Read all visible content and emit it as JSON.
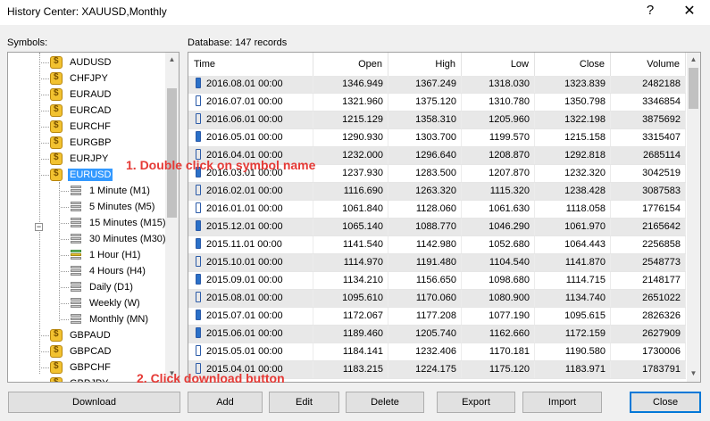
{
  "window": {
    "title": "History Center: XAUUSD,Monthly",
    "help_icon": "?",
    "close_icon": "✕"
  },
  "symbols_label": "Symbols:",
  "database_label": "Database: 147 records",
  "tree": {
    "symbols_before": [
      "AUDUSD",
      "CHFJPY",
      "EURAUD",
      "EURCAD",
      "EURCHF",
      "EURGBP",
      "EURJPY"
    ],
    "selected_symbol": "EURUSD",
    "timeframes": [
      "1 Minute (M1)",
      "5 Minutes (M5)",
      "15 Minutes (M15)",
      "30 Minutes (M30)",
      "1 Hour (H1)",
      "4 Hours (H4)",
      "Daily (D1)",
      "Weekly (W)",
      "Monthly (MN)"
    ],
    "symbols_after": [
      "GBPAUD",
      "GBPCAD",
      "GBPCHF",
      "GBPJPY"
    ]
  },
  "table": {
    "columns": [
      "Time",
      "Open",
      "High",
      "Low",
      "Close",
      "Volume"
    ],
    "rows": [
      [
        "2016.08.01 00:00",
        "1346.949",
        "1367.249",
        "1318.030",
        "1323.839",
        "2482188"
      ],
      [
        "2016.07.01 00:00",
        "1321.960",
        "1375.120",
        "1310.780",
        "1350.798",
        "3346854"
      ],
      [
        "2016.06.01 00:00",
        "1215.129",
        "1358.310",
        "1205.960",
        "1322.198",
        "3875692"
      ],
      [
        "2016.05.01 00:00",
        "1290.930",
        "1303.700",
        "1199.570",
        "1215.158",
        "3315407"
      ],
      [
        "2016.04.01 00:00",
        "1232.000",
        "1296.640",
        "1208.870",
        "1292.818",
        "2685114"
      ],
      [
        "2016.03.01 00:00",
        "1237.930",
        "1283.500",
        "1207.870",
        "1232.320",
        "3042519"
      ],
      [
        "2016.02.01 00:00",
        "1116.690",
        "1263.320",
        "1115.320",
        "1238.428",
        "3087583"
      ],
      [
        "2016.01.01 00:00",
        "1061.840",
        "1128.060",
        "1061.630",
        "1118.058",
        "1776154"
      ],
      [
        "2015.12.01 00:00",
        "1065.140",
        "1088.770",
        "1046.290",
        "1061.970",
        "2165642"
      ],
      [
        "2015.11.01 00:00",
        "1141.540",
        "1142.980",
        "1052.680",
        "1064.443",
        "2256858"
      ],
      [
        "2015.10.01 00:00",
        "1114.970",
        "1191.480",
        "1104.540",
        "1141.870",
        "2548773"
      ],
      [
        "2015.09.01 00:00",
        "1134.210",
        "1156.650",
        "1098.680",
        "1114.715",
        "2148177"
      ],
      [
        "2015.08.01 00:00",
        "1095.610",
        "1170.060",
        "1080.900",
        "1134.740",
        "2651022"
      ],
      [
        "2015.07.01 00:00",
        "1172.067",
        "1177.208",
        "1077.190",
        "1095.615",
        "2826326"
      ],
      [
        "2015.06.01 00:00",
        "1189.460",
        "1205.740",
        "1162.660",
        "1172.159",
        "2627909"
      ],
      [
        "2015.05.01 00:00",
        "1184.141",
        "1232.406",
        "1170.181",
        "1190.580",
        "1730006"
      ],
      [
        "2015.04.01 00:00",
        "1183.215",
        "1224.175",
        "1175.120",
        "1183.971",
        "1783791"
      ]
    ],
    "bullish": [
      false,
      true,
      true,
      false,
      true,
      false,
      true,
      true,
      false,
      false,
      true,
      false,
      true,
      false,
      false,
      true,
      true
    ]
  },
  "buttons": {
    "download": "Download",
    "add": "Add",
    "edit": "Edit",
    "delete": "Delete",
    "export": "Export",
    "import": "Import",
    "close": "Close"
  },
  "annotations": {
    "step1": "1. Double click on symbol name",
    "step2": "2. Click download button"
  }
}
